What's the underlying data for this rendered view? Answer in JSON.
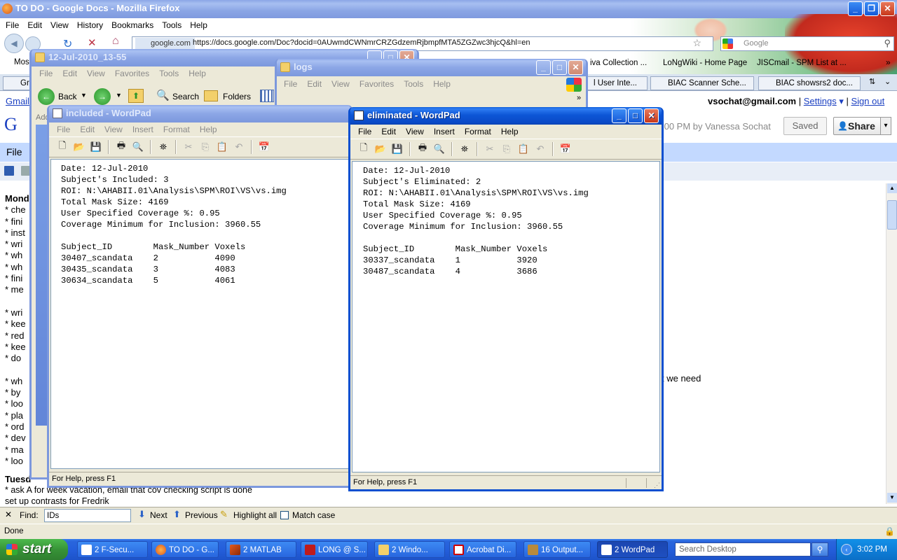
{
  "firefox": {
    "title": "TO DO - Google Docs - Mozilla Firefox",
    "menu": [
      "File",
      "Edit",
      "View",
      "History",
      "Bookmarks",
      "Tools",
      "Help"
    ],
    "url_domain": "google.com",
    "url": "https://docs.google.com/Doc?docid=0AUwmdCWNmrCRZGdzemRjbmpfMTA5ZGZwc3hjcQ&hl=en",
    "search_placeholder": "Google",
    "bookmarks": [
      "Mos",
      "iva Collection ...",
      "LoNgWiki - Home Page",
      "JISCmail - SPM List at ..."
    ],
    "tabs": [
      "Gr",
      "l User Inte...",
      "BIAC Scanner Sche...",
      "BIAC showsrs2 doc..."
    ],
    "gmail_link": "Gmail",
    "user_email": "vsochat@gmail.com",
    "settings_link": "Settings",
    "signout_link": "Sign out",
    "doc_meta": ":00 PM by Vanessa Sochat",
    "saved_label": "Saved",
    "share_label": "Share",
    "docs_file_menu": "File",
    "doc_fragment_right": "t we need",
    "doc_visible_lines": [
      "Mond",
      "* che",
      "* fini",
      "* inst",
      "* wri",
      "* wh",
      "* wh",
      "* fini",
      "* me",
      "",
      "* wri",
      "* kee",
      "* red",
      "* kee",
      "* do",
      "",
      "* wh",
      "* by",
      "* loo",
      "* pla",
      "* ord",
      "* dev",
      "* ma",
      "* loo"
    ],
    "tuesday_label": "Tuesd",
    "tuesday_lines": [
      "* ask A for week vacation, email that cov checking script is done",
      "  set up contrasts for Fredrik"
    ],
    "find": {
      "label": "Find:",
      "value": "IDs",
      "next": "Next",
      "previous": "Previous",
      "highlight_all": "Highlight all",
      "match_case": "Match case"
    },
    "status": "Done"
  },
  "explorer_window": {
    "title": "12-Jul-2010_13-55",
    "menu": [
      "File",
      "Edit",
      "View",
      "Favorites",
      "Tools",
      "Help"
    ],
    "back_label": "Back",
    "search_label": "Search",
    "folders_label": "Folders",
    "address_fragment": "Add"
  },
  "logs_window": {
    "title": "logs",
    "menu": [
      "File",
      "Edit",
      "View",
      "Favorites",
      "Tools",
      "Help"
    ]
  },
  "included_window": {
    "title": "included - WordPad",
    "menu": [
      "File",
      "Edit",
      "View",
      "Insert",
      "Format",
      "Help"
    ],
    "lines": [
      "Date: 12-Jul-2010",
      "Subject's Included: 3",
      "ROI: N:\\AHABII.01\\Analysis\\SPM\\ROI\\VS\\vs.img",
      "Total Mask Size: 4169",
      "User Specified Coverage %: 0.95",
      "Coverage Minimum for Inclusion: 3960.55",
      "",
      "Subject_ID        Mask_Number Voxels",
      "30407_scandata    2           4090",
      "30435_scandata    3           4083",
      "30634_scandata    5           4061"
    ],
    "status": "For Help, press F1"
  },
  "eliminated_window": {
    "title": "eliminated - WordPad",
    "menu": [
      "File",
      "Edit",
      "View",
      "Insert",
      "Format",
      "Help"
    ],
    "lines": [
      "Date: 12-Jul-2010",
      "Subject's Eliminated: 2",
      "ROI: N:\\AHABII.01\\Analysis\\SPM\\ROI\\VS\\vs.img",
      "Total Mask Size: 4169",
      "User Specified Coverage %: 0.95",
      "Coverage Minimum for Inclusion: 3960.55",
      "",
      "Subject_ID        Mask_Number Voxels",
      "30337_scandata    1           3920",
      "30487_scandata    4           3686"
    ],
    "status": "For Help, press F1"
  },
  "taskbar": {
    "start": "start",
    "buttons": [
      "2 F-Secu...",
      "TO DO - G...",
      "2 MATLAB",
      "LONG @ S...",
      "2 Windo...",
      "Acrobat Di...",
      "16 Output...",
      "2 WordPad"
    ],
    "search_placeholder": "Search Desktop",
    "clock": "3:02 PM"
  },
  "colors": {
    "xp_blue": "#0a4fd0",
    "taskbar_blue": "#245edb",
    "start_green": "#379337",
    "google_blue": "#1a3fc1"
  }
}
